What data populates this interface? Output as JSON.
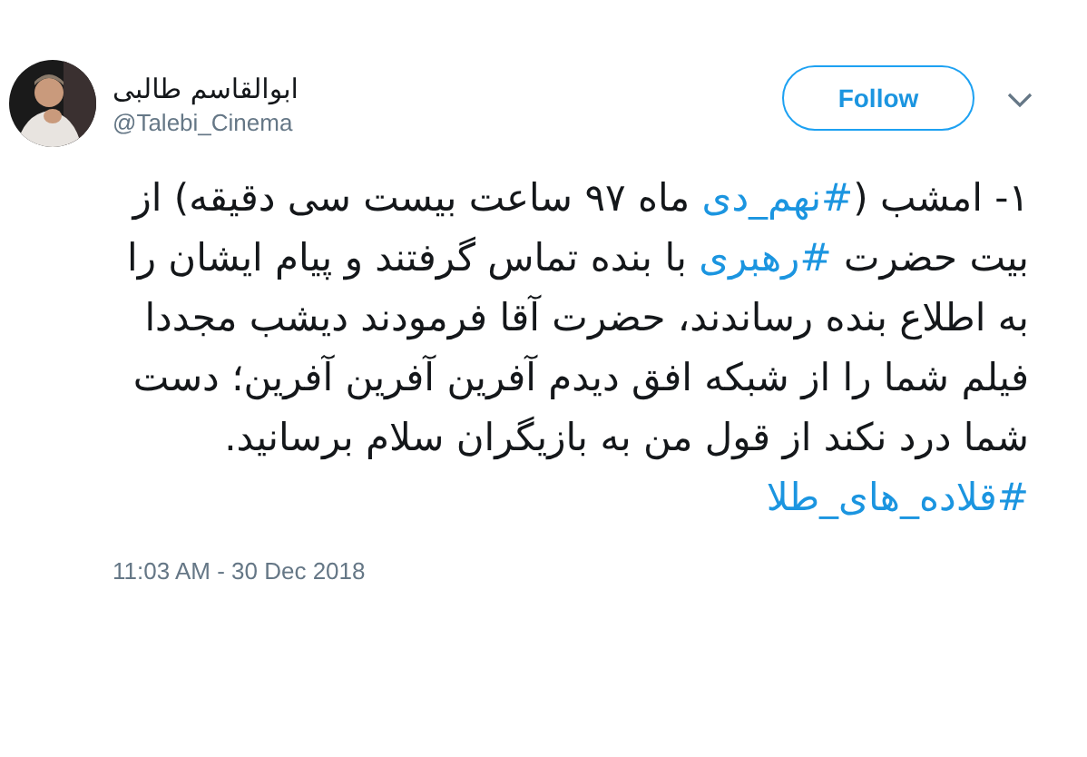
{
  "author": {
    "name": "ابوالقاسم طالبی",
    "handle": "@Talebi_Cinema"
  },
  "follow_button": {
    "label": "Follow"
  },
  "body": [
    {
      "kind": "text",
      "text": "۱- امشب ("
    },
    {
      "kind": "hashtag",
      "text": "#نهم_دی"
    },
    {
      "kind": "text",
      "text": " ماه ۹۷ ساعت بیست سی دقیقه) از بیت حضرت "
    },
    {
      "kind": "hashtag",
      "text": "#رهبری"
    },
    {
      "kind": "text",
      "text": " با بنده تماس گرفتند و پیام ایشان را به اطلاع بنده رساندند، حضرت آقا فرمودند دیشب مجددا فیلم شما را از شبکه افق دیدم آفرین آفرین آفرین؛ دست شما درد نکند از قول من به بازیگران سلام برسانید."
    }
  ],
  "footer_hashtag": "#قلاده_های_طلا",
  "timestamp": "11:03 AM - 30 Dec 2018"
}
